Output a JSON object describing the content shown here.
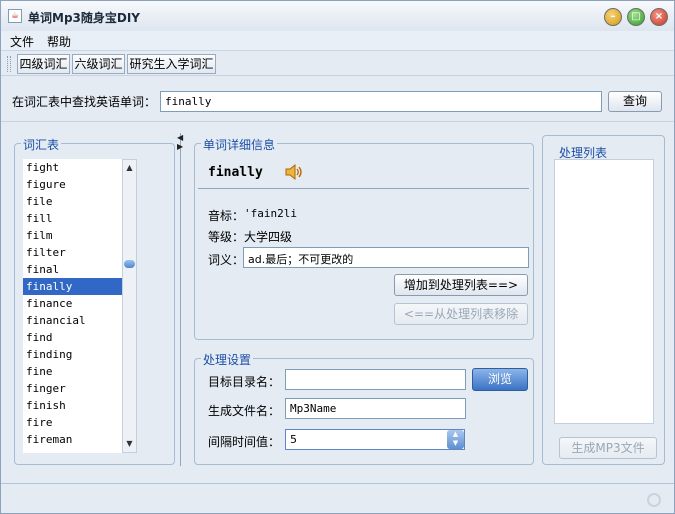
{
  "window": {
    "title": "单词Mp3随身宝DIY",
    "app_icon": "java-cup-icon"
  },
  "menu": [
    "文件",
    "帮助"
  ],
  "levels": [
    "四级词汇",
    "六级词汇",
    "研究生入学词汇"
  ],
  "search": {
    "label": "在词汇表中查找英语单词：",
    "value": "finally",
    "button": "查询"
  },
  "vocab": {
    "legend": "词汇表",
    "items": [
      "fight",
      "figure",
      "file",
      "fill",
      "film",
      "filter",
      "final",
      "finally",
      "finance",
      "financial",
      "find",
      "finding",
      "fine",
      "finger",
      "finish",
      "fire",
      "fireman"
    ],
    "selected": "finally"
  },
  "detail": {
    "legend": "单词详细信息",
    "word": "finally",
    "speaker_icon": "speaker-icon",
    "phonetic_label": "音标：",
    "phonetic": "'fain2li",
    "level_label": "等级：",
    "level": "大学四级",
    "def_label": "词义：",
    "definition": "ad.最后；不可更改的",
    "add_button": "增加到处理列表==>",
    "remove_button": "<==从处理列表移除"
  },
  "settings": {
    "legend": "处理设置",
    "target_label": "目标目录名：",
    "target_value": "",
    "browse_button": "浏览",
    "filename_label": "生成文件名：",
    "filename_value": "Mp3Name",
    "interval_label": "间隔时间值：",
    "interval_value": "5"
  },
  "process": {
    "legend": "处理列表",
    "items": [],
    "generate_button": "生成MP3文件"
  }
}
